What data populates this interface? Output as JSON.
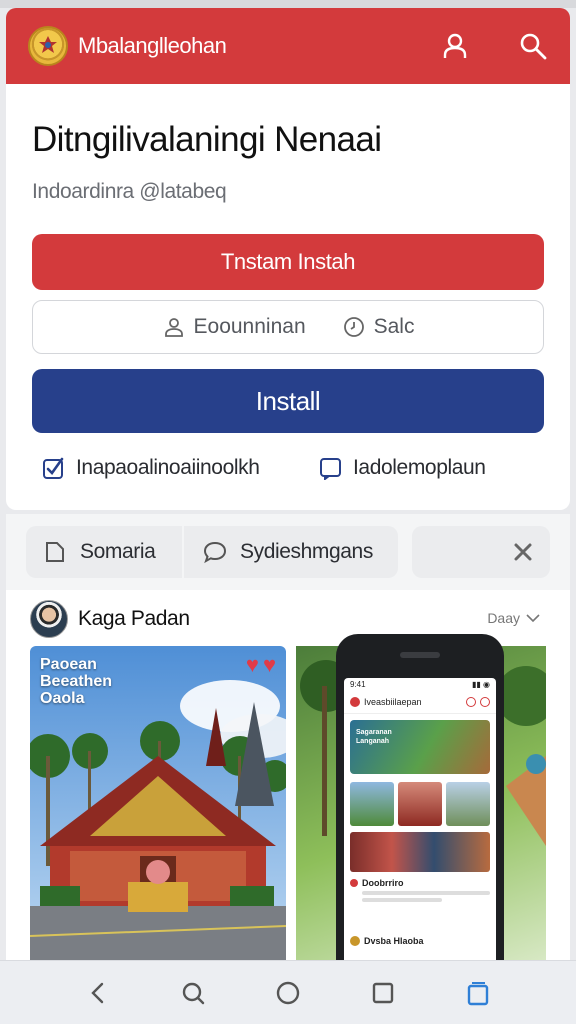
{
  "header": {
    "app_name": "Mbalanglleohan",
    "icons": [
      "logo-emblem-icon",
      "user-icon",
      "search-icon"
    ],
    "color": "#d33a3c"
  },
  "card": {
    "title": "Ditngilivalaningi Nenaai",
    "subtitle": "Indoardinra @latabeq",
    "primary_button": "Tnstam Instah",
    "secondary_left": "Eoounninan",
    "secondary_right": "Salc",
    "install_button": "Install",
    "checkbox_left": {
      "label": "Inapaoalinoaiinoolkh",
      "checked": true
    },
    "checkbox_right": {
      "label": "Iadolemoplaun",
      "checked": false
    }
  },
  "tabs": [
    {
      "label": "Somaria",
      "icon": "document-icon"
    },
    {
      "label": "Sydieshmgans",
      "icon": "chat-bubble-icon"
    }
  ],
  "post": {
    "author": "Kaga Padan",
    "meta": "Daay",
    "photo_caption": "Paoean\nBeeathen\nOaola",
    "phone_screen": {
      "header_title": "Iveasbiilaepan",
      "banner_text": "Sagaranan Langanah",
      "item_1": "Doobrriro",
      "item_2": "Dvsba Hlaoba"
    }
  },
  "colors": {
    "red": "#d33a3c",
    "navy": "#27408b",
    "background": "#e9eaed"
  },
  "nav_icons": [
    "back-icon",
    "search-icon",
    "home-icon",
    "recents-icon",
    "tabs-icon"
  ]
}
